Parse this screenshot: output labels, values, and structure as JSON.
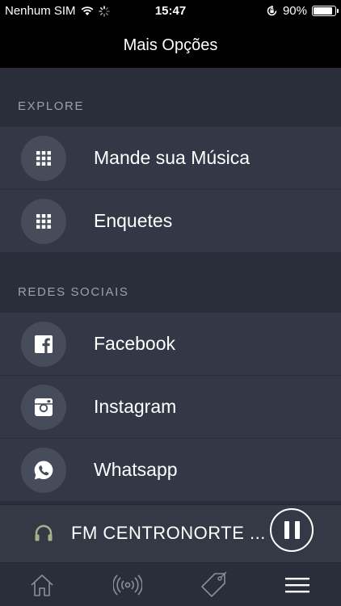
{
  "status_bar": {
    "carrier": "Nenhum SIM",
    "time": "15:47",
    "battery_percent_text": "90%",
    "battery_level": 0.9
  },
  "nav": {
    "title": "Mais Opções"
  },
  "sections": [
    {
      "header": "EXPLORE",
      "items": [
        {
          "label": "Mande sua Música",
          "icon": "grid-icon"
        },
        {
          "label": "Enquetes",
          "icon": "grid-icon"
        }
      ]
    },
    {
      "header": "REDES SOCIAIS",
      "items": [
        {
          "label": "Facebook",
          "icon": "facebook-icon"
        },
        {
          "label": "Instagram",
          "icon": "instagram-icon"
        },
        {
          "label": "Whatsapp",
          "icon": "whatsapp-icon"
        }
      ]
    }
  ],
  "player": {
    "station": "FM CENTRONORTE ...",
    "icon_color": "#a8b08a"
  },
  "tabs": [
    {
      "icon": "home-icon"
    },
    {
      "icon": "radio-broadcast-icon"
    },
    {
      "icon": "tag-icon"
    },
    {
      "icon": "menu-icon"
    }
  ],
  "colors": {
    "background": "#2a2e3a",
    "row": "#333847",
    "icon_circle": "#474c5a",
    "header_text": "#9aa0ad"
  }
}
